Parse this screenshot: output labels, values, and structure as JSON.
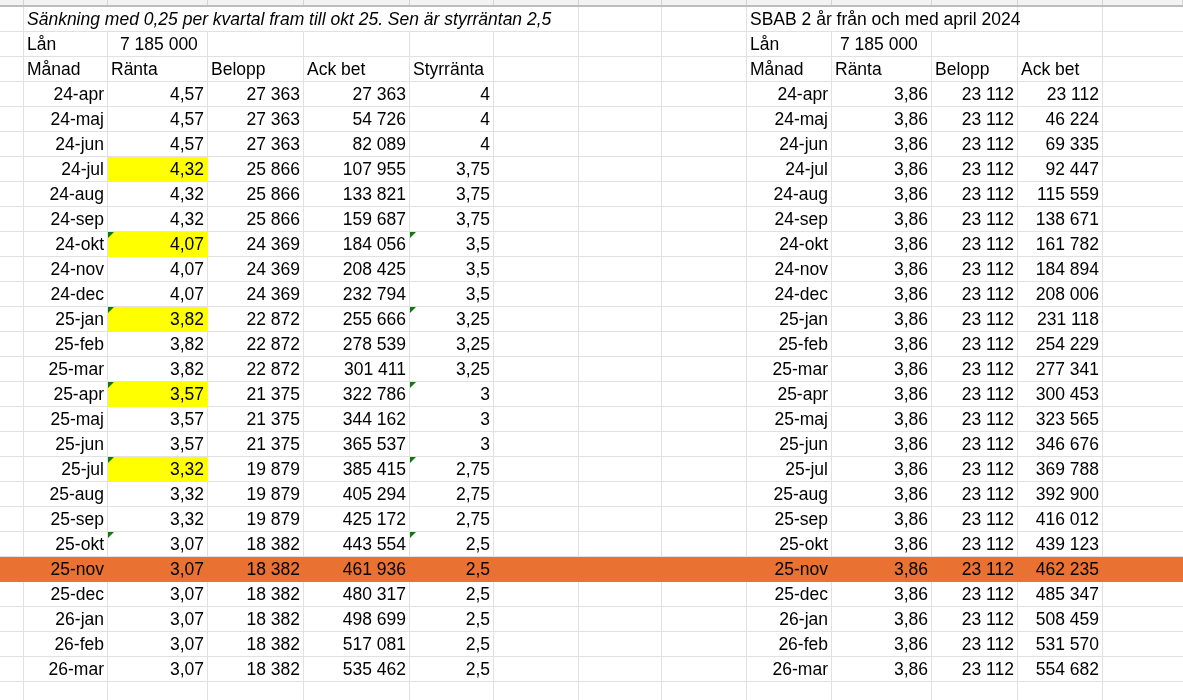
{
  "left_table": {
    "title": "Sänkning med 0,25 per kvartal fram till okt 25. Sen är styrräntan 2,5",
    "title_italic": true,
    "loan_label": "Lån",
    "loan_value": "7 185 000",
    "columns": [
      "Månad",
      "Ränta",
      "Belopp",
      "Ack bet",
      "Styrränta"
    ],
    "rows": [
      {
        "month": "24-apr",
        "rate": "4,57",
        "rate_highlighted": false,
        "rate_flagged": false,
        "amount": "27 363",
        "cumulative": "27 363",
        "policy_rate": "4",
        "policy_flagged": false,
        "highlighted": false
      },
      {
        "month": "24-maj",
        "rate": "4,57",
        "rate_highlighted": false,
        "rate_flagged": false,
        "amount": "27 363",
        "cumulative": "54 726",
        "policy_rate": "4",
        "policy_flagged": false,
        "highlighted": false
      },
      {
        "month": "24-jun",
        "rate": "4,57",
        "rate_highlighted": false,
        "rate_flagged": false,
        "amount": "27 363",
        "cumulative": "82 089",
        "policy_rate": "4",
        "policy_flagged": false,
        "highlighted": false
      },
      {
        "month": "24-jul",
        "rate": "4,32",
        "rate_highlighted": true,
        "rate_flagged": false,
        "amount": "25 866",
        "cumulative": "107 955",
        "policy_rate": "3,75",
        "policy_flagged": false,
        "highlighted": false
      },
      {
        "month": "24-aug",
        "rate": "4,32",
        "rate_highlighted": false,
        "rate_flagged": false,
        "amount": "25 866",
        "cumulative": "133 821",
        "policy_rate": "3,75",
        "policy_flagged": false,
        "highlighted": false
      },
      {
        "month": "24-sep",
        "rate": "4,32",
        "rate_highlighted": false,
        "rate_flagged": false,
        "amount": "25 866",
        "cumulative": "159 687",
        "policy_rate": "3,75",
        "policy_flagged": false,
        "highlighted": false
      },
      {
        "month": "24-okt",
        "rate": "4,07",
        "rate_highlighted": true,
        "rate_flagged": true,
        "amount": "24 369",
        "cumulative": "184 056",
        "policy_rate": "3,5",
        "policy_flagged": true,
        "highlighted": false
      },
      {
        "month": "24-nov",
        "rate": "4,07",
        "rate_highlighted": false,
        "rate_flagged": false,
        "amount": "24 369",
        "cumulative": "208 425",
        "policy_rate": "3,5",
        "policy_flagged": false,
        "highlighted": false
      },
      {
        "month": "24-dec",
        "rate": "4,07",
        "rate_highlighted": false,
        "rate_flagged": false,
        "amount": "24 369",
        "cumulative": "232 794",
        "policy_rate": "3,5",
        "policy_flagged": false,
        "highlighted": false
      },
      {
        "month": "25-jan",
        "rate": "3,82",
        "rate_highlighted": true,
        "rate_flagged": true,
        "amount": "22 872",
        "cumulative": "255 666",
        "policy_rate": "3,25",
        "policy_flagged": true,
        "highlighted": false
      },
      {
        "month": "25-feb",
        "rate": "3,82",
        "rate_highlighted": false,
        "rate_flagged": false,
        "amount": "22 872",
        "cumulative": "278 539",
        "policy_rate": "3,25",
        "policy_flagged": false,
        "highlighted": false
      },
      {
        "month": "25-mar",
        "rate": "3,82",
        "rate_highlighted": false,
        "rate_flagged": false,
        "amount": "22 872",
        "cumulative": "301 411",
        "policy_rate": "3,25",
        "policy_flagged": false,
        "highlighted": false
      },
      {
        "month": "25-apr",
        "rate": "3,57",
        "rate_highlighted": true,
        "rate_flagged": true,
        "amount": "21 375",
        "cumulative": "322 786",
        "policy_rate": "3",
        "policy_flagged": true,
        "highlighted": false
      },
      {
        "month": "25-maj",
        "rate": "3,57",
        "rate_highlighted": false,
        "rate_flagged": false,
        "amount": "21 375",
        "cumulative": "344 162",
        "policy_rate": "3",
        "policy_flagged": false,
        "highlighted": false
      },
      {
        "month": "25-jun",
        "rate": "3,57",
        "rate_highlighted": false,
        "rate_flagged": false,
        "amount": "21 375",
        "cumulative": "365 537",
        "policy_rate": "3",
        "policy_flagged": false,
        "highlighted": false
      },
      {
        "month": "25-jul",
        "rate": "3,32",
        "rate_highlighted": true,
        "rate_flagged": true,
        "amount": "19 879",
        "cumulative": "385 415",
        "policy_rate": "2,75",
        "policy_flagged": true,
        "highlighted": false
      },
      {
        "month": "25-aug",
        "rate": "3,32",
        "rate_highlighted": false,
        "rate_flagged": false,
        "amount": "19 879",
        "cumulative": "405 294",
        "policy_rate": "2,75",
        "policy_flagged": false,
        "highlighted": false
      },
      {
        "month": "25-sep",
        "rate": "3,32",
        "rate_highlighted": false,
        "rate_flagged": false,
        "amount": "19 879",
        "cumulative": "425 172",
        "policy_rate": "2,75",
        "policy_flagged": false,
        "highlighted": false
      },
      {
        "month": "25-okt",
        "rate": "3,07",
        "rate_highlighted": false,
        "rate_flagged": true,
        "amount": "18 382",
        "cumulative": "443 554",
        "policy_rate": "2,5",
        "policy_flagged": true,
        "highlighted": false
      },
      {
        "month": "25-nov",
        "rate": "3,07",
        "rate_highlighted": false,
        "rate_flagged": false,
        "amount": "18 382",
        "cumulative": "461 936",
        "policy_rate": "2,5",
        "policy_flagged": false,
        "highlighted": true
      },
      {
        "month": "25-dec",
        "rate": "3,07",
        "rate_highlighted": false,
        "rate_flagged": false,
        "amount": "18 382",
        "cumulative": "480 317",
        "policy_rate": "2,5",
        "policy_flagged": false,
        "highlighted": false
      },
      {
        "month": "26-jan",
        "rate": "3,07",
        "rate_highlighted": false,
        "rate_flagged": false,
        "amount": "18 382",
        "cumulative": "498 699",
        "policy_rate": "2,5",
        "policy_flagged": false,
        "highlighted": false
      },
      {
        "month": "26-feb",
        "rate": "3,07",
        "rate_highlighted": false,
        "rate_flagged": false,
        "amount": "18 382",
        "cumulative": "517 081",
        "policy_rate": "2,5",
        "policy_flagged": false,
        "highlighted": false
      },
      {
        "month": "26-mar",
        "rate": "3,07",
        "rate_highlighted": false,
        "rate_flagged": false,
        "amount": "18 382",
        "cumulative": "535 462",
        "policy_rate": "2,5",
        "policy_flagged": false,
        "highlighted": false
      }
    ]
  },
  "right_table": {
    "title": "SBAB 2 år från och med april 2024",
    "title_italic": false,
    "loan_label": "Lån",
    "loan_value": "7 185 000",
    "columns": [
      "Månad",
      "Ränta",
      "Belopp",
      "Ack bet"
    ],
    "rows": [
      {
        "month": "24-apr",
        "rate": "3,86",
        "amount": "23 112",
        "cumulative": "23 112",
        "highlighted": false
      },
      {
        "month": "24-maj",
        "rate": "3,86",
        "amount": "23 112",
        "cumulative": "46 224",
        "highlighted": false
      },
      {
        "month": "24-jun",
        "rate": "3,86",
        "amount": "23 112",
        "cumulative": "69 335",
        "highlighted": false
      },
      {
        "month": "24-jul",
        "rate": "3,86",
        "amount": "23 112",
        "cumulative": "92 447",
        "highlighted": false
      },
      {
        "month": "24-aug",
        "rate": "3,86",
        "amount": "23 112",
        "cumulative": "115 559",
        "highlighted": false
      },
      {
        "month": "24-sep",
        "rate": "3,86",
        "amount": "23 112",
        "cumulative": "138 671",
        "highlighted": false
      },
      {
        "month": "24-okt",
        "rate": "3,86",
        "amount": "23 112",
        "cumulative": "161 782",
        "highlighted": false
      },
      {
        "month": "24-nov",
        "rate": "3,86",
        "amount": "23 112",
        "cumulative": "184 894",
        "highlighted": false
      },
      {
        "month": "24-dec",
        "rate": "3,86",
        "amount": "23 112",
        "cumulative": "208 006",
        "highlighted": false
      },
      {
        "month": "25-jan",
        "rate": "3,86",
        "amount": "23 112",
        "cumulative": "231 118",
        "highlighted": false
      },
      {
        "month": "25-feb",
        "rate": "3,86",
        "amount": "23 112",
        "cumulative": "254 229",
        "highlighted": false
      },
      {
        "month": "25-mar",
        "rate": "3,86",
        "amount": "23 112",
        "cumulative": "277 341",
        "highlighted": false
      },
      {
        "month": "25-apr",
        "rate": "3,86",
        "amount": "23 112",
        "cumulative": "300 453",
        "highlighted": false
      },
      {
        "month": "25-maj",
        "rate": "3,86",
        "amount": "23 112",
        "cumulative": "323 565",
        "highlighted": false
      },
      {
        "month": "25-jun",
        "rate": "3,86",
        "amount": "23 112",
        "cumulative": "346 676",
        "highlighted": false
      },
      {
        "month": "25-jul",
        "rate": "3,86",
        "amount": "23 112",
        "cumulative": "369 788",
        "highlighted": false
      },
      {
        "month": "25-aug",
        "rate": "3,86",
        "amount": "23 112",
        "cumulative": "392 900",
        "highlighted": false
      },
      {
        "month": "25-sep",
        "rate": "3,86",
        "amount": "23 112",
        "cumulative": "416 012",
        "highlighted": false
      },
      {
        "month": "25-okt",
        "rate": "3,86",
        "amount": "23 112",
        "cumulative": "439 123",
        "highlighted": false
      },
      {
        "month": "25-nov",
        "rate": "3,86",
        "amount": "23 112",
        "cumulative": "462 235",
        "highlighted": true
      },
      {
        "month": "25-dec",
        "rate": "3,86",
        "amount": "23 112",
        "cumulative": "485 347",
        "highlighted": false
      },
      {
        "month": "26-jan",
        "rate": "3,86",
        "amount": "23 112",
        "cumulative": "508 459",
        "highlighted": false
      },
      {
        "month": "26-feb",
        "rate": "3,86",
        "amount": "23 112",
        "cumulative": "531 570",
        "highlighted": false
      },
      {
        "month": "26-mar",
        "rate": "3,86",
        "amount": "23 112",
        "cumulative": "554 682",
        "highlighted": false
      }
    ]
  }
}
